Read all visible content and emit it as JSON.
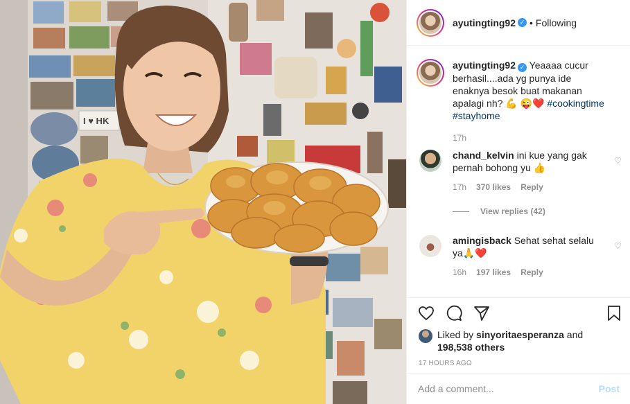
{
  "header": {
    "username": "ayutingting92",
    "separator": "•",
    "follow_status": "Following"
  },
  "caption": {
    "username": "ayutingting92",
    "text": "Yeaaaa cucur berhasil....ada yg punya ide enaknya besok buat makanan apalagi nh? 💪",
    "emoji_line": "😜❤️",
    "hashtags": "#cookingtime #stayhome",
    "time": "17h"
  },
  "comments": [
    {
      "username": "chand_kelvin",
      "text": "ini kue yang gak pernah bohong yu 👍",
      "time": "17h",
      "likes": "370 likes",
      "reply": "Reply",
      "view_replies": "View replies (42)"
    },
    {
      "username": "amingisback",
      "text": "Sehat sehat selalu ya🙏❤️",
      "time": "16h",
      "likes": "197 likes",
      "reply": "Reply"
    }
  ],
  "likes": {
    "liked_by_prefix": "Liked by",
    "liked_by_user": "sinyoritaesperanza",
    "and": "and",
    "others": "198,538 others"
  },
  "post_time": "17 HOURS AGO",
  "add_comment": {
    "placeholder": "Add a comment...",
    "post_label": "Post"
  },
  "photo": {
    "magnet_label": "I ♥ HK"
  },
  "colors": {
    "verified": "#3897f0",
    "hashtag": "#00376b",
    "muted": "#8e8e8e",
    "post_button": "#b2dffc",
    "heart": "#e0245e"
  },
  "icons": [
    "verified-badge-icon",
    "heart-icon",
    "comment-icon",
    "share-icon",
    "bookmark-icon",
    "small-heart-icon"
  ]
}
